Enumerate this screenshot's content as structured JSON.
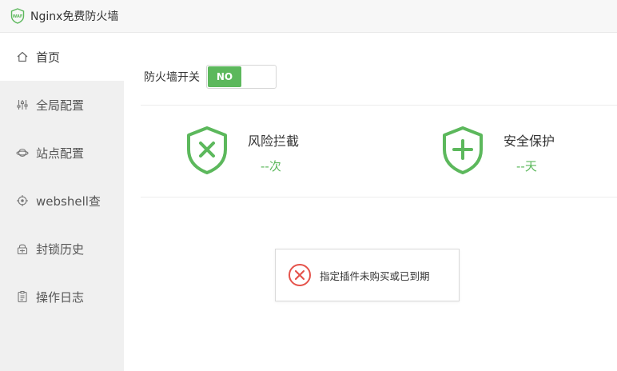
{
  "app": {
    "title": "Nginx免费防火墙",
    "accent_color": "#5cb85c",
    "error_color": "#e5534b"
  },
  "sidebar": {
    "items": [
      {
        "label": "首页",
        "icon": "home-icon",
        "active": true
      },
      {
        "label": "全局配置",
        "icon": "sliders-icon",
        "active": false
      },
      {
        "label": "站点配置",
        "icon": "planet-icon",
        "active": false
      },
      {
        "label": "webshell查",
        "icon": "crosshair-icon",
        "active": false
      },
      {
        "label": "封锁历史",
        "icon": "lock-icon",
        "active": false
      },
      {
        "label": "操作日志",
        "icon": "clipboard-icon",
        "active": false
      }
    ]
  },
  "firewall_switch": {
    "label": "防火墙开关",
    "state_label": "NO"
  },
  "stats": [
    {
      "title": "风险拦截",
      "value": "--",
      "unit": "次",
      "icon": "shield-x-icon"
    },
    {
      "title": "安全保护",
      "value": "--",
      "unit": "天",
      "icon": "shield-plus-icon"
    }
  ],
  "notice": {
    "message": "指定插件未购买或已到期",
    "icon": "error-circle-icon"
  }
}
